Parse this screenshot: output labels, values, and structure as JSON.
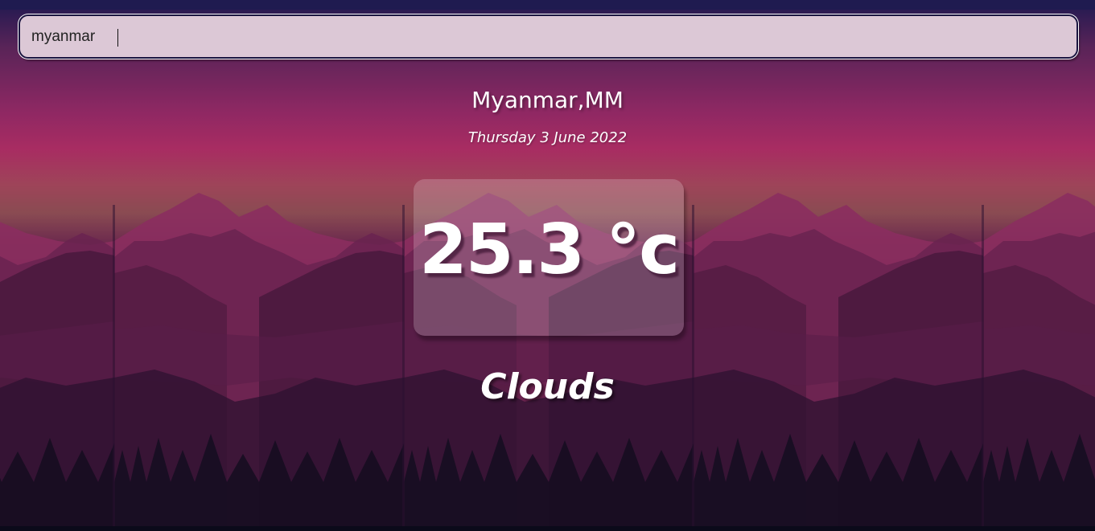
{
  "search": {
    "value": "myanmar",
    "placeholder": ""
  },
  "location": {
    "label": "Myanmar,MM"
  },
  "date": {
    "label": "Thursday 3 June 2022"
  },
  "weather": {
    "temperature": "25.3 °c",
    "condition": "Clouds"
  },
  "colors": {
    "search_background": "#dcc8d6",
    "sky_magenta": "#a82c62",
    "mountain_far": "#8e2e5e",
    "mountain_mid": "#5a1f45",
    "valley_dark": "#2a1230",
    "text": "#ffffff"
  },
  "icons": {
    "background": "mountain-landscape-illustration"
  }
}
